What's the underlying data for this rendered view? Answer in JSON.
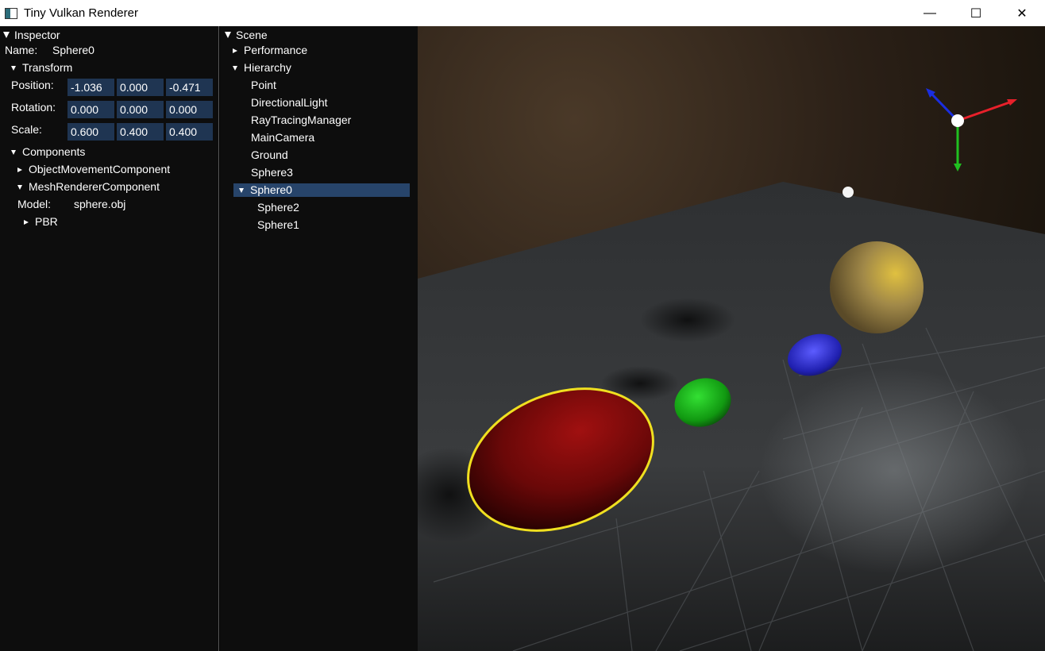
{
  "window": {
    "title": "Tiny Vulkan Renderer",
    "minimize_glyph": "—",
    "maximize_glyph": "☐",
    "close_glyph": "✕"
  },
  "inspector": {
    "header": "Inspector",
    "name_label": "Name:",
    "name_value": "Sphere0",
    "transform_label": "Transform",
    "position_label": "Position:",
    "position": [
      "-1.036",
      "0.000",
      "-0.471"
    ],
    "rotation_label": "Rotation:",
    "rotation": [
      "0.000",
      "0.000",
      "0.000"
    ],
    "scale_label": "Scale:",
    "scale": [
      "0.600",
      "0.400",
      "0.400"
    ],
    "components_label": "Components",
    "component_1": "ObjectMovementComponent",
    "component_2": "MeshRendererComponent",
    "model_label": "Model:",
    "model_value": "sphere.obj",
    "pbr_label": "PBR"
  },
  "scene": {
    "header": "Scene",
    "performance_label": "Performance",
    "hierarchy_label": "Hierarchy",
    "items": [
      "Point",
      "DirectionalLight",
      "RayTracingManager",
      "MainCamera",
      "Ground",
      "Sphere3"
    ],
    "selected_item": "Sphere0",
    "children": [
      "Sphere2",
      "Sphere1"
    ]
  },
  "colors": {
    "selection": "#27446a",
    "field_bg": "#1f3552",
    "outline_highlight": "#f0e020",
    "gizmo_x": "#e8202a",
    "gizmo_y": "#20c020",
    "gizmo_z": "#1a2ee0"
  }
}
